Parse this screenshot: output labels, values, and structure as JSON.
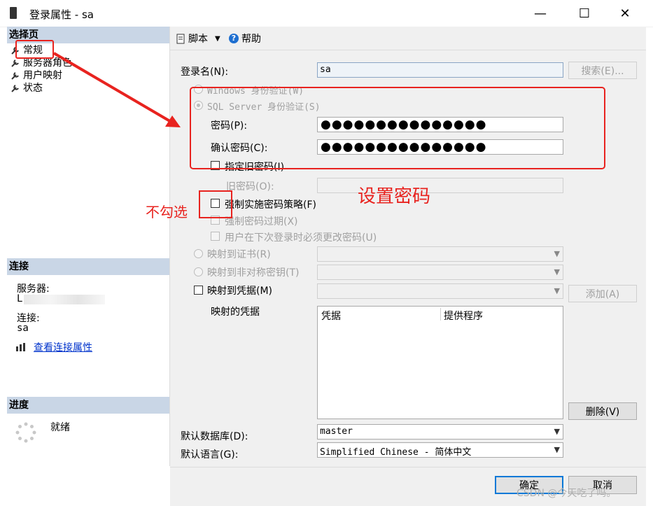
{
  "window": {
    "title": "登录属性 - sa",
    "controls": {
      "minimize": "—",
      "maximize": "☐",
      "close": "✕"
    }
  },
  "left": {
    "select_page_header": "选择页",
    "nav": [
      {
        "label": "常规"
      },
      {
        "label": "服务器角色"
      },
      {
        "label": "用户映射"
      },
      {
        "label": "状态"
      }
    ],
    "connection_header": "连接",
    "server_label": "服务器:",
    "server_value": "L",
    "connection_label": "连接:",
    "connection_value": "sa",
    "view_connection_link": "查看连接属性",
    "progress_header": "进度",
    "progress_status": "就绪"
  },
  "toolbar": {
    "script_label": "脚本",
    "help_label": "帮助"
  },
  "form": {
    "login_name_label": "登录名(N):",
    "login_name_value": "sa",
    "search_button": "搜索(E)...",
    "windows_auth": "Windows 身份验证(W)",
    "sql_auth": "SQL Server 身份验证(S)",
    "password_label": "密码(P):",
    "password_value": "●●●●●●●●●●●●●●●",
    "confirm_label": "确认密码(C):",
    "confirm_value": "●●●●●●●●●●●●●●●",
    "specify_old": "指定旧密码(I)",
    "old_password_label": "旧密码(O):",
    "enforce_policy": "强制实施密码策略(F)",
    "enforce_expiration": "强制密码过期(X)",
    "must_change": "用户在下次登录时必须更改密码(U)",
    "map_cert": "映射到证书(R)",
    "map_asym": "映射到非对称密钥(T)",
    "map_cred": "映射到凭据(M)",
    "add_button": "添加(A)",
    "mapped_creds_label": "映射的凭据",
    "cred_columns": [
      "凭据",
      "提供程序"
    ],
    "remove_button": "删除(V)",
    "default_db_label": "默认数据库(D):",
    "default_db_value": "master",
    "default_lang_label": "默认语言(G):",
    "default_lang_value": "Simplified Chinese - 简体中文"
  },
  "footer": {
    "ok_button": "确定",
    "cancel_button": "取消"
  },
  "annotations": {
    "set_password": "设置密码",
    "dont_check": "不勾选",
    "accent_color": "#e8231f"
  },
  "watermark": "CSDN @今天吃了吗。"
}
